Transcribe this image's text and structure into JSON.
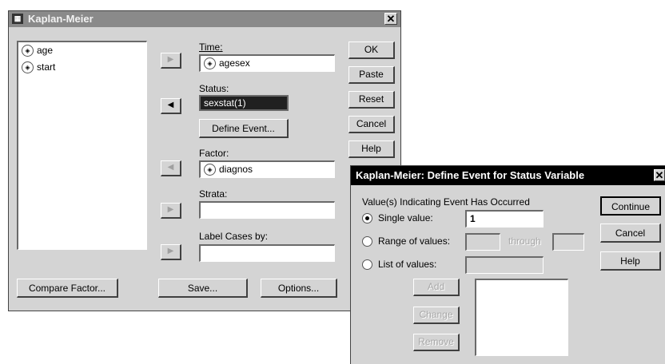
{
  "main_window": {
    "title": "Kaplan-Meier",
    "close_glyph": "✕",
    "variables": [
      {
        "name": "age",
        "icon": "scale-variable-icon"
      },
      {
        "name": "start",
        "icon": "scale-variable-icon"
      }
    ],
    "time_label": "Time:",
    "time_value": "agesex",
    "status_label": "Status:",
    "status_value": "sexstat(1)",
    "define_event_label": "Define Event...",
    "factor_label": "Factor:",
    "factor_value": "diagnos",
    "strata_label": "Strata:",
    "label_cases_label": "Label Cases by:",
    "buttons": {
      "ok": "OK",
      "paste": "Paste",
      "reset": "Reset",
      "cancel": "Cancel",
      "help": "Help",
      "compare_factor": "Compare Factor...",
      "save": "Save...",
      "options": "Options..."
    }
  },
  "define_event_dialog": {
    "title": "Kaplan-Meier: Define Event for Status Variable",
    "group_label": "Value(s) Indicating Event Has Occurred",
    "single_value_label": "Single value:",
    "single_value": "1",
    "range_label": "Range of values:",
    "through_label": "through",
    "list_label": "List of values:",
    "add_label": "Add",
    "change_label": "Change",
    "remove_label": "Remove",
    "continue_label": "Continue",
    "cancel_label": "Cancel",
    "help_label": "Help",
    "selected_option": "single"
  }
}
